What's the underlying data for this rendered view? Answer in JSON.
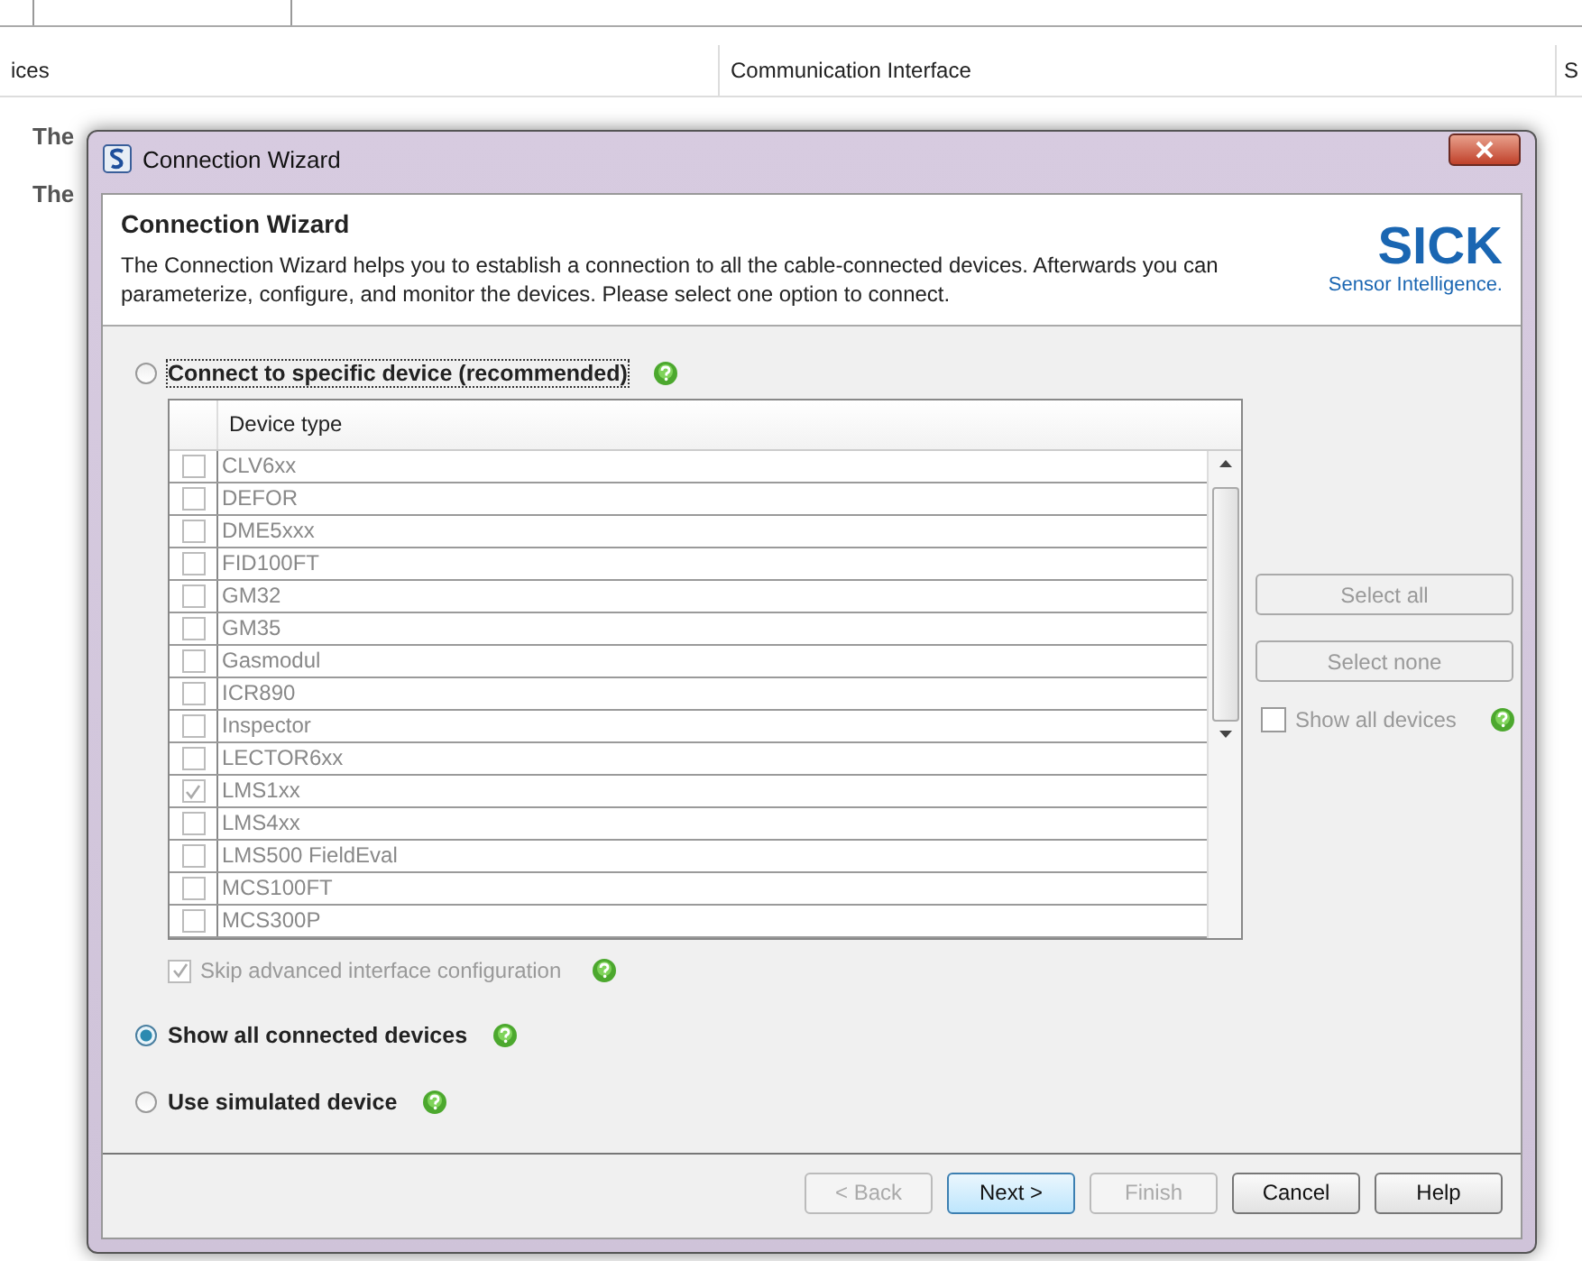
{
  "background": {
    "columns": [
      "ices",
      "Communication Interface",
      "S"
    ],
    "texts": [
      "The",
      "The"
    ]
  },
  "dialog": {
    "title": "Connection Wizard",
    "header": {
      "heading": "Connection Wizard",
      "description": "The Connection Wizard helps you to establish a connection to all the cable-connected devices. Afterwards you can parameterize, configure, and monitor the devices. Please select one option to connect.",
      "logo_text": "SICK",
      "logo_tagline": "Sensor Intelligence."
    },
    "options": [
      {
        "label": "Connect to specific device (recommended)",
        "selected": false
      },
      {
        "label": "Show all connected devices",
        "selected": true
      },
      {
        "label": "Use simulated device",
        "selected": false
      }
    ],
    "device_table": {
      "column": "Device type",
      "rows": [
        {
          "name": "CLV6xx",
          "checked": false
        },
        {
          "name": "DEFOR",
          "checked": false
        },
        {
          "name": "DME5xxx",
          "checked": false
        },
        {
          "name": "FID100FT",
          "checked": false
        },
        {
          "name": "GM32",
          "checked": false
        },
        {
          "name": "GM35",
          "checked": false
        },
        {
          "name": "Gasmodul",
          "checked": false
        },
        {
          "name": "ICR890",
          "checked": false
        },
        {
          "name": "Inspector",
          "checked": false
        },
        {
          "name": "LECTOR6xx",
          "checked": false
        },
        {
          "name": "LMS1xx",
          "checked": true
        },
        {
          "name": "LMS4xx",
          "checked": false
        },
        {
          "name": "LMS500 FieldEval",
          "checked": false
        },
        {
          "name": "MCS100FT",
          "checked": false
        },
        {
          "name": "MCS300P",
          "checked": false
        }
      ]
    },
    "side_buttons": [
      {
        "label": "Select all",
        "disabled": true
      },
      {
        "label": "Select none",
        "disabled": true
      }
    ],
    "show_all_devices": {
      "label": "Show all devices",
      "checked": false
    },
    "skip_advanced": {
      "label": "Skip advanced interface configuration",
      "checked": true
    },
    "buttons": [
      {
        "label": "< Back",
        "disabled": true,
        "default": false
      },
      {
        "label": "Next >",
        "disabled": false,
        "default": true
      },
      {
        "label": "Finish",
        "disabled": true,
        "default": false
      },
      {
        "label": "Cancel",
        "disabled": false,
        "default": false
      },
      {
        "label": "Help",
        "disabled": false,
        "default": false
      }
    ]
  }
}
